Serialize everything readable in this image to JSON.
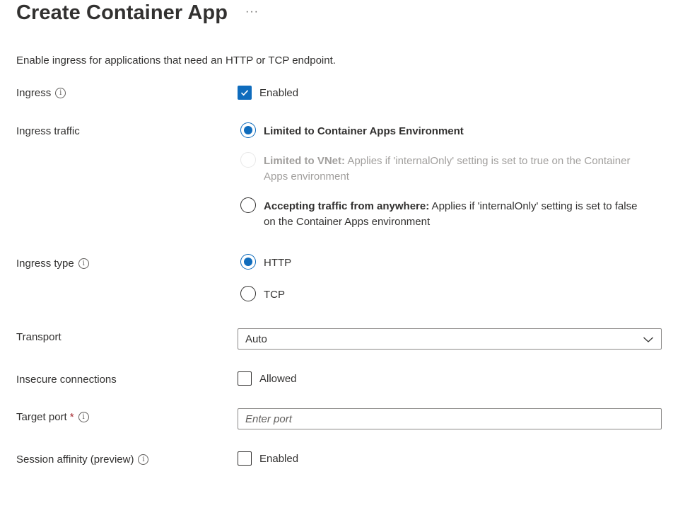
{
  "header": {
    "title": "Create Container App",
    "more_label": "···"
  },
  "description": "Enable ingress for applications that need an HTTP or TCP endpoint.",
  "ingress": {
    "label": "Ingress",
    "checked": true,
    "checkbox_label": "Enabled"
  },
  "ingress_traffic": {
    "label": "Ingress traffic",
    "options": [
      {
        "title": "Limited to Container Apps Environment",
        "detail": "",
        "selected": true,
        "disabled": false
      },
      {
        "title": "Limited to VNet:",
        "detail": " Applies if 'internalOnly' setting is set to true on the Container Apps environment",
        "selected": false,
        "disabled": true
      },
      {
        "title": "Accepting traffic from anywhere:",
        "detail": " Applies if 'internalOnly' setting is set to false on the Container Apps environment",
        "selected": false,
        "disabled": false
      }
    ]
  },
  "ingress_type": {
    "label": "Ingress type",
    "options": [
      {
        "label": "HTTP",
        "selected": true
      },
      {
        "label": "TCP",
        "selected": false
      }
    ]
  },
  "transport": {
    "label": "Transport",
    "value": "Auto"
  },
  "insecure": {
    "label": "Insecure connections",
    "checked": false,
    "checkbox_label": "Allowed"
  },
  "target_port": {
    "label": "Target port",
    "required_mark": "*",
    "value": "",
    "placeholder": "Enter port"
  },
  "session_affinity": {
    "label": "Session affinity (preview)",
    "checked": false,
    "checkbox_label": "Enabled"
  },
  "info_glyph": "i",
  "colors": {
    "accent": "#0f6cbd",
    "text": "#323130",
    "disabled_text": "#a19f9d",
    "required": "#a4262c"
  }
}
